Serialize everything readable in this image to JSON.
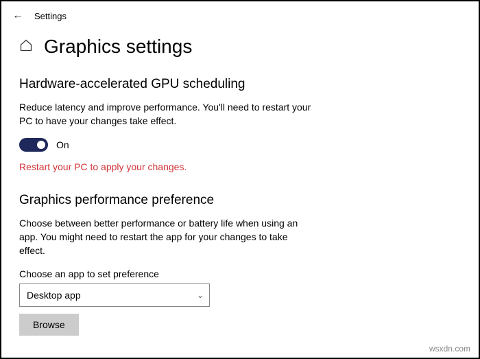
{
  "header": {
    "title": "Settings"
  },
  "page": {
    "title": "Graphics settings"
  },
  "gpu_section": {
    "heading": "Hardware-accelerated GPU scheduling",
    "description": "Reduce latency and improve performance. You'll need to restart your PC to have your changes take effect.",
    "toggle_state": "On",
    "warning": "Restart your PC to apply your changes."
  },
  "perf_section": {
    "heading": "Graphics performance preference",
    "description": "Choose between better performance or battery life when using an app. You might need to restart the app for your changes to take effect.",
    "dropdown_label": "Choose an app to set preference",
    "dropdown_value": "Desktop app",
    "browse_label": "Browse"
  },
  "watermark": "wsxdn.com"
}
